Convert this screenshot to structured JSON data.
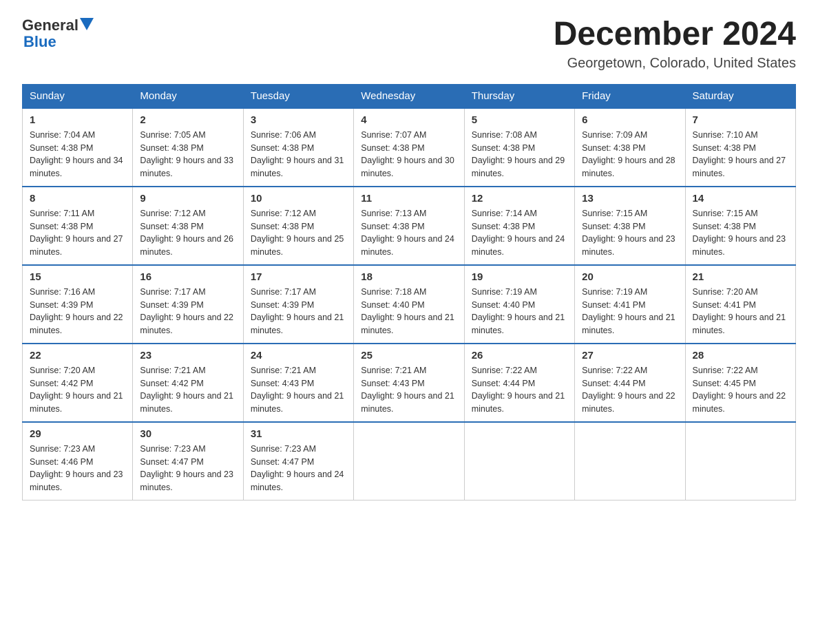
{
  "logo": {
    "general": "General",
    "blue": "Blue"
  },
  "header": {
    "month": "December 2024",
    "location": "Georgetown, Colorado, United States"
  },
  "days_of_week": [
    "Sunday",
    "Monday",
    "Tuesday",
    "Wednesday",
    "Thursday",
    "Friday",
    "Saturday"
  ],
  "weeks": [
    [
      {
        "day": "1",
        "sunrise": "7:04 AM",
        "sunset": "4:38 PM",
        "daylight": "9 hours and 34 minutes."
      },
      {
        "day": "2",
        "sunrise": "7:05 AM",
        "sunset": "4:38 PM",
        "daylight": "9 hours and 33 minutes."
      },
      {
        "day": "3",
        "sunrise": "7:06 AM",
        "sunset": "4:38 PM",
        "daylight": "9 hours and 31 minutes."
      },
      {
        "day": "4",
        "sunrise": "7:07 AM",
        "sunset": "4:38 PM",
        "daylight": "9 hours and 30 minutes."
      },
      {
        "day": "5",
        "sunrise": "7:08 AM",
        "sunset": "4:38 PM",
        "daylight": "9 hours and 29 minutes."
      },
      {
        "day": "6",
        "sunrise": "7:09 AM",
        "sunset": "4:38 PM",
        "daylight": "9 hours and 28 minutes."
      },
      {
        "day": "7",
        "sunrise": "7:10 AM",
        "sunset": "4:38 PM",
        "daylight": "9 hours and 27 minutes."
      }
    ],
    [
      {
        "day": "8",
        "sunrise": "7:11 AM",
        "sunset": "4:38 PM",
        "daylight": "9 hours and 27 minutes."
      },
      {
        "day": "9",
        "sunrise": "7:12 AM",
        "sunset": "4:38 PM",
        "daylight": "9 hours and 26 minutes."
      },
      {
        "day": "10",
        "sunrise": "7:12 AM",
        "sunset": "4:38 PM",
        "daylight": "9 hours and 25 minutes."
      },
      {
        "day": "11",
        "sunrise": "7:13 AM",
        "sunset": "4:38 PM",
        "daylight": "9 hours and 24 minutes."
      },
      {
        "day": "12",
        "sunrise": "7:14 AM",
        "sunset": "4:38 PM",
        "daylight": "9 hours and 24 minutes."
      },
      {
        "day": "13",
        "sunrise": "7:15 AM",
        "sunset": "4:38 PM",
        "daylight": "9 hours and 23 minutes."
      },
      {
        "day": "14",
        "sunrise": "7:15 AM",
        "sunset": "4:38 PM",
        "daylight": "9 hours and 23 minutes."
      }
    ],
    [
      {
        "day": "15",
        "sunrise": "7:16 AM",
        "sunset": "4:39 PM",
        "daylight": "9 hours and 22 minutes."
      },
      {
        "day": "16",
        "sunrise": "7:17 AM",
        "sunset": "4:39 PM",
        "daylight": "9 hours and 22 minutes."
      },
      {
        "day": "17",
        "sunrise": "7:17 AM",
        "sunset": "4:39 PM",
        "daylight": "9 hours and 21 minutes."
      },
      {
        "day": "18",
        "sunrise": "7:18 AM",
        "sunset": "4:40 PM",
        "daylight": "9 hours and 21 minutes."
      },
      {
        "day": "19",
        "sunrise": "7:19 AM",
        "sunset": "4:40 PM",
        "daylight": "9 hours and 21 minutes."
      },
      {
        "day": "20",
        "sunrise": "7:19 AM",
        "sunset": "4:41 PM",
        "daylight": "9 hours and 21 minutes."
      },
      {
        "day": "21",
        "sunrise": "7:20 AM",
        "sunset": "4:41 PM",
        "daylight": "9 hours and 21 minutes."
      }
    ],
    [
      {
        "day": "22",
        "sunrise": "7:20 AM",
        "sunset": "4:42 PM",
        "daylight": "9 hours and 21 minutes."
      },
      {
        "day": "23",
        "sunrise": "7:21 AM",
        "sunset": "4:42 PM",
        "daylight": "9 hours and 21 minutes."
      },
      {
        "day": "24",
        "sunrise": "7:21 AM",
        "sunset": "4:43 PM",
        "daylight": "9 hours and 21 minutes."
      },
      {
        "day": "25",
        "sunrise": "7:21 AM",
        "sunset": "4:43 PM",
        "daylight": "9 hours and 21 minutes."
      },
      {
        "day": "26",
        "sunrise": "7:22 AM",
        "sunset": "4:44 PM",
        "daylight": "9 hours and 21 minutes."
      },
      {
        "day": "27",
        "sunrise": "7:22 AM",
        "sunset": "4:44 PM",
        "daylight": "9 hours and 22 minutes."
      },
      {
        "day": "28",
        "sunrise": "7:22 AM",
        "sunset": "4:45 PM",
        "daylight": "9 hours and 22 minutes."
      }
    ],
    [
      {
        "day": "29",
        "sunrise": "7:23 AM",
        "sunset": "4:46 PM",
        "daylight": "9 hours and 23 minutes."
      },
      {
        "day": "30",
        "sunrise": "7:23 AM",
        "sunset": "4:47 PM",
        "daylight": "9 hours and 23 minutes."
      },
      {
        "day": "31",
        "sunrise": "7:23 AM",
        "sunset": "4:47 PM",
        "daylight": "9 hours and 24 minutes."
      },
      null,
      null,
      null,
      null
    ]
  ],
  "labels": {
    "sunrise": "Sunrise:",
    "sunset": "Sunset:",
    "daylight": "Daylight:"
  }
}
